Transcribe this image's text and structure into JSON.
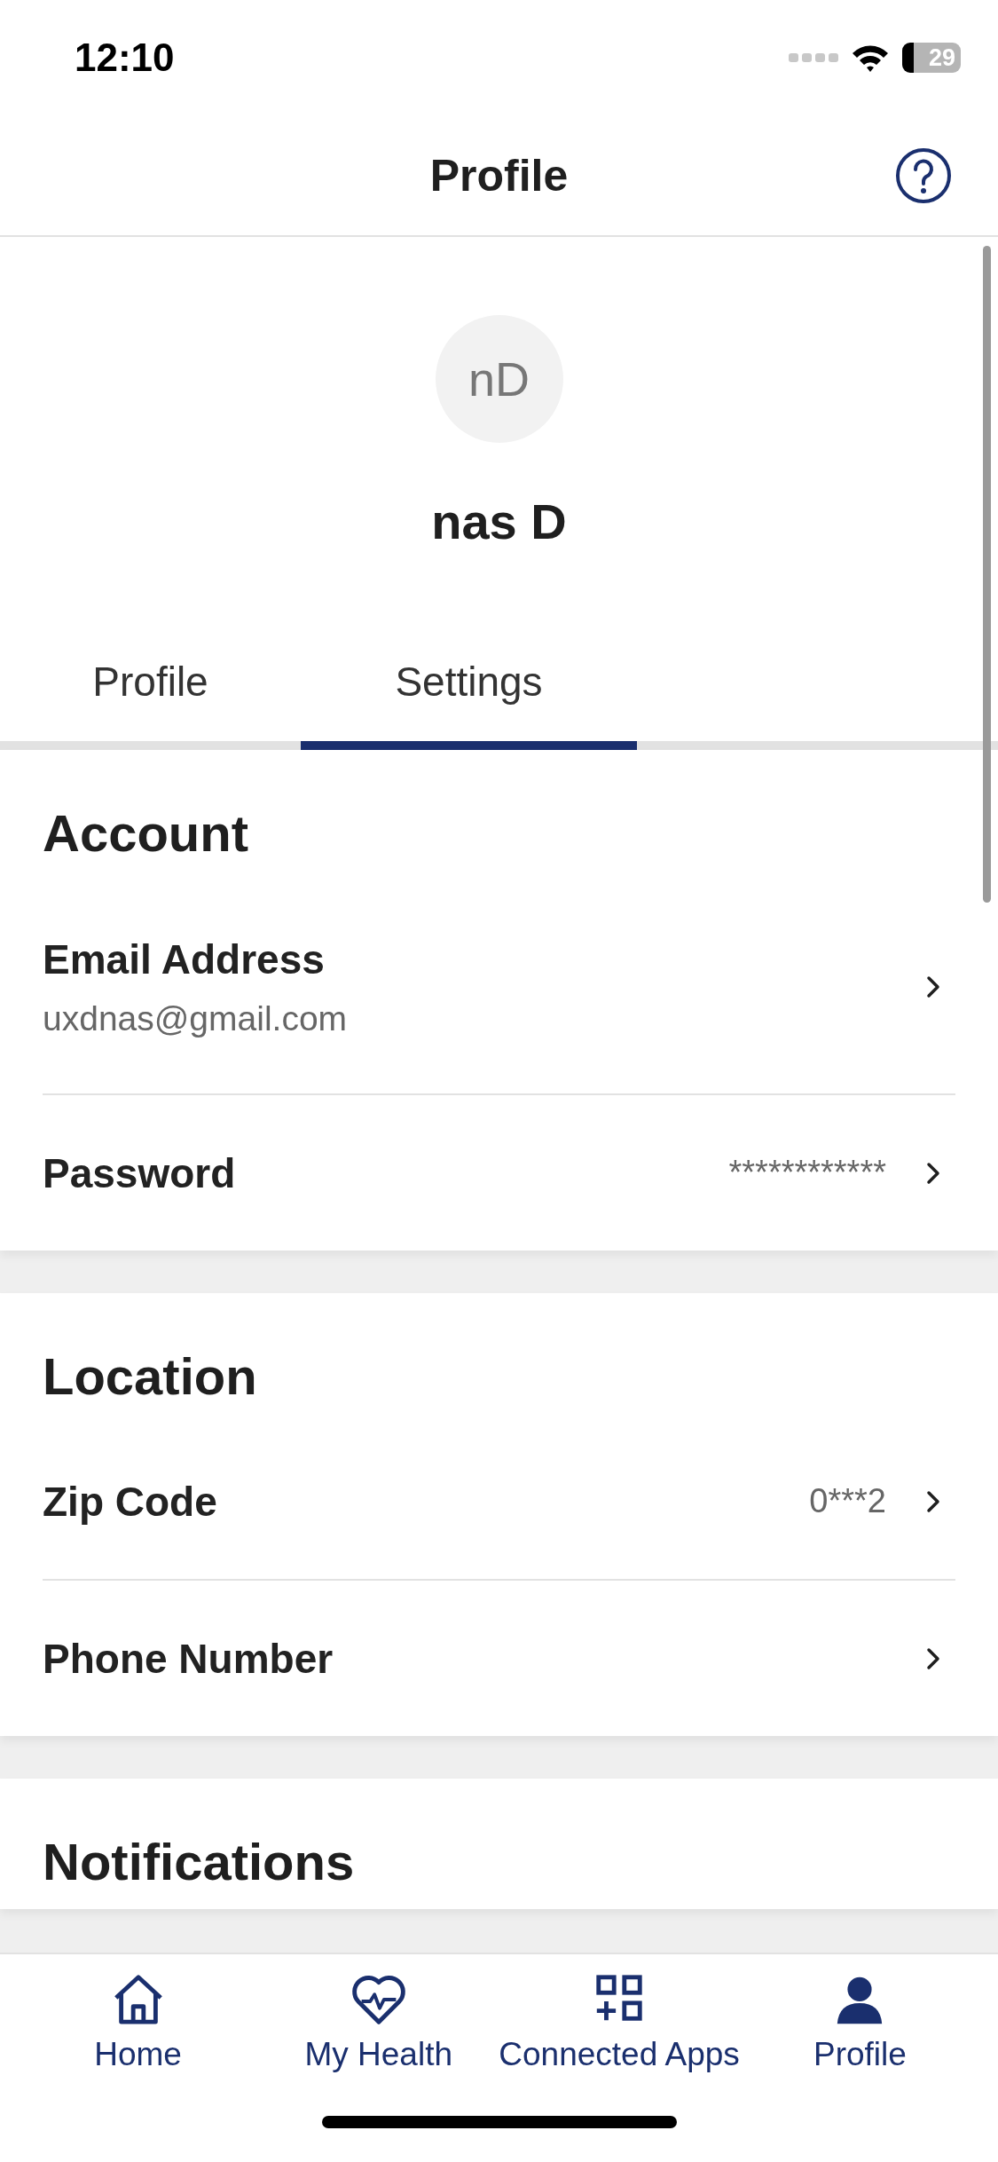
{
  "status_bar": {
    "time": "12:10",
    "battery": "29"
  },
  "header": {
    "title": "Profile"
  },
  "profile": {
    "initials": "nD",
    "name": "nas D"
  },
  "tabs": [
    {
      "label": "Profile",
      "selected": false
    },
    {
      "label": "Settings",
      "selected": true
    }
  ],
  "sections": [
    {
      "title": "Account",
      "rows": [
        {
          "kind": "detail",
          "label": "Email Address",
          "value": "uxdnas@gmail.com"
        },
        {
          "kind": "inline",
          "label": "Password",
          "value": "************"
        }
      ]
    },
    {
      "title": "Location",
      "rows": [
        {
          "kind": "inline",
          "label": "Zip Code",
          "value": "0***2"
        },
        {
          "kind": "inline",
          "label": "Phone Number"
        }
      ]
    },
    {
      "title": "Notifications"
    }
  ],
  "bottom_nav": [
    {
      "label": "Home",
      "selected": false
    },
    {
      "label": "My Health",
      "selected": false
    },
    {
      "label": "Connected Apps",
      "selected": false
    },
    {
      "label": "Profile",
      "selected": true
    }
  ]
}
